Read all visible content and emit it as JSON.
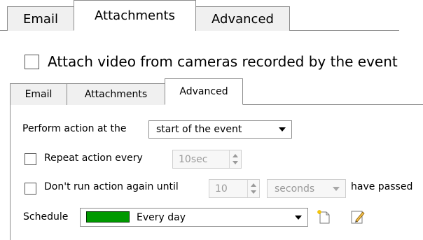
{
  "top": {
    "tabs": {
      "email": "Email",
      "attachments": "Attachments",
      "advanced": "Advanced"
    },
    "attach_video_label": "Attach video from cameras recorded by the event"
  },
  "bottom": {
    "tabs": {
      "email": "Email",
      "attachments": "Attachments",
      "advanced": "Advanced"
    },
    "perform_label": "Perform action at the",
    "perform_value": "start of the event",
    "repeat_label": "Repeat action every",
    "repeat_value": "10sec",
    "dont_run_label": "Don't run action again until",
    "dont_run_number": "10",
    "dont_run_unit": "seconds",
    "have_passed_label": "have passed",
    "schedule_label": "Schedule",
    "schedule_value": "Every day",
    "schedule_color": "#009900",
    "icons": [
      "new-schedule-icon",
      "edit-schedule-icon"
    ]
  }
}
